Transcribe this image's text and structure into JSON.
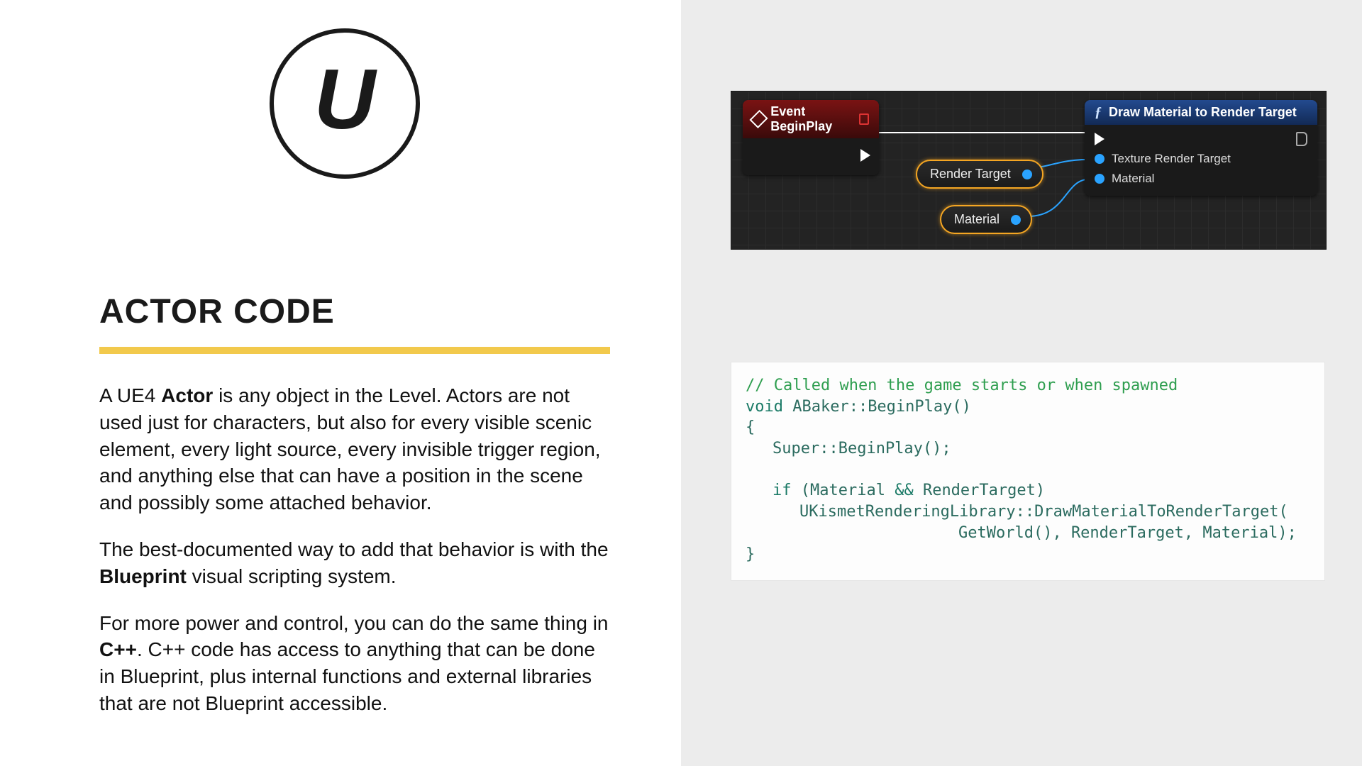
{
  "title": "ACTOR CODE",
  "logo_glyph": "U",
  "para1_a": "A UE4 ",
  "para1_b": "Actor",
  "para1_c": " is any object in the Level. Actors are not used just for characters, but also for every visible scenic element, every light source, every invisible trigger region, and anything else that can have a position in the scene and possibly some attached behavior.",
  "para2_a": "The best-documented way to add that behavior is with the ",
  "para2_b": "Blueprint",
  "para2_c": " visual scripting system.",
  "para3_a": "For more power and control, you can do the same thing in ",
  "para3_b": "C++",
  "para3_c": ". C++ code has access to anything that can be done in Blueprint, plus internal functions and external libraries that are not Blueprint accessible.",
  "bp": {
    "event_title": "Event BeginPlay",
    "func_title": "Draw Material to Render Target",
    "func_pin1": "Texture Render Target",
    "func_pin2": "Material",
    "pill_render": "Render Target",
    "pill_material": "Material"
  },
  "code": {
    "l1": "// Called when the game starts or when spawned",
    "l2a": "void",
    "l2b": " ABaker::BeginPlay()",
    "l3": "{",
    "l4": "Super::BeginPlay();",
    "l5a": "if",
    "l5b": " (Material ",
    "l5c": "&&",
    "l5d": " RenderTarget)",
    "l6": "UKismetRenderingLibrary::DrawMaterialToRenderTarget(",
    "l7": "GetWorld(), RenderTarget, Material);",
    "l8": "}"
  }
}
